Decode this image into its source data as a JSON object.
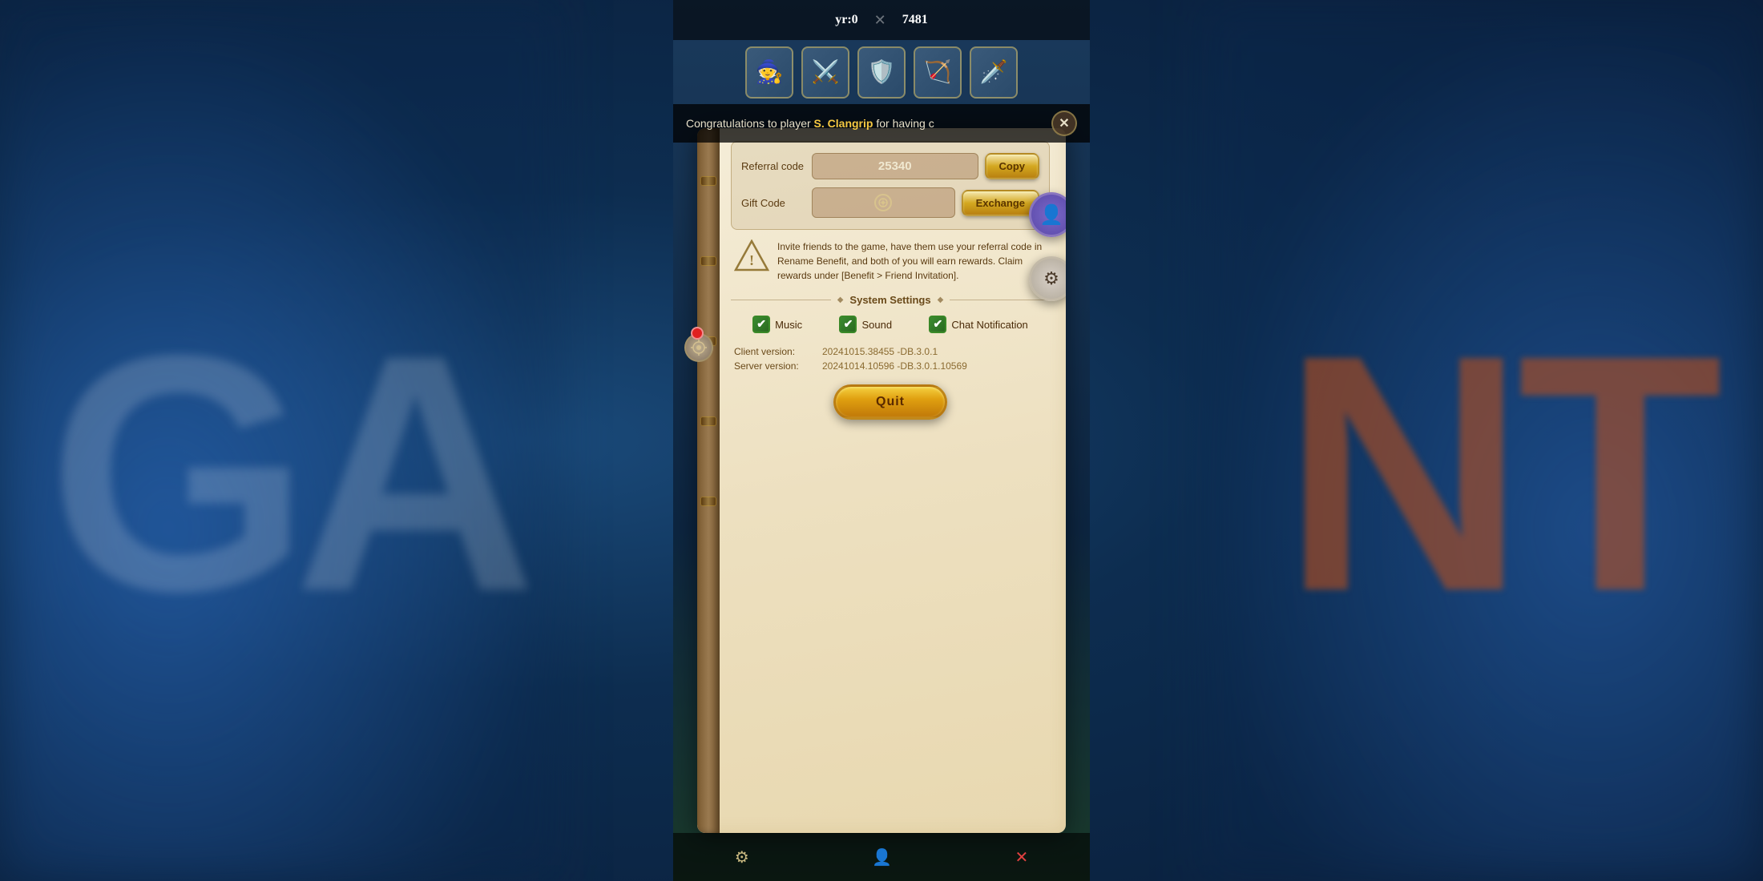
{
  "background": {
    "textLeft": "GA",
    "textRight": "NT"
  },
  "topBar": {
    "stat1Label": "yr:0",
    "stat2Label": "✕",
    "stat2Value": "7481"
  },
  "notification": {
    "text": "Congratulations to player ",
    "playerName": "S. Clangrip",
    "textSuffix": " for having c"
  },
  "closeButton": {
    "label": "✕"
  },
  "referralSection": {
    "referralLabel": "Referral code",
    "referralValue": "25340",
    "copyButtonLabel": "Copy",
    "giftCodeLabel": "Gift Code",
    "giftCodePlaceholder": "",
    "exchangeButtonLabel": "Exchange"
  },
  "infoText": "Invite friends to the game, have them use your referral code in Rename Benefit, and both of you will earn rewards. Claim rewards under [Benefit > Friend Invitation].",
  "systemSettings": {
    "label": "System Settings",
    "decoratorLeft": "◆━━",
    "decoratorRight": "━━◆"
  },
  "checkboxes": [
    {
      "id": "music",
      "label": "Music",
      "checked": true
    },
    {
      "id": "sound",
      "label": "Sound",
      "checked": true
    },
    {
      "id": "chatNotif",
      "label": "Chat Notification",
      "checked": true
    }
  ],
  "versionInfo": {
    "clientLabel": "Client version:",
    "clientValue": "20241015.38455 -DB.3.0.1",
    "serverLabel": "Server version:",
    "serverValue": "20241014.10596 -DB.3.0.1.10569"
  },
  "quitButton": {
    "label": "Quit"
  },
  "bottomBar": {
    "items": [
      {
        "label": "⚙",
        "name": "settings"
      },
      {
        "label": "👤",
        "name": "profile"
      },
      {
        "label": "✕",
        "name": "close"
      }
    ]
  },
  "sideButtons": {
    "profileIcon": "👤",
    "settingsIcon": "⚙"
  },
  "characters": [
    "🧙",
    "⚔️",
    "🛡️",
    "🏹",
    "🗡️"
  ]
}
